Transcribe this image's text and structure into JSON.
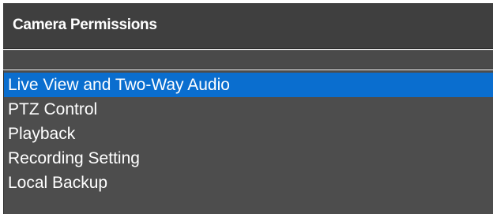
{
  "header": {
    "title": "Camera Permissions"
  },
  "permissions": {
    "items": [
      {
        "label": "Live View and Two-Way Audio",
        "selected": true
      },
      {
        "label": "PTZ Control",
        "selected": false
      },
      {
        "label": "Playback",
        "selected": false
      },
      {
        "label": "Recording Setting",
        "selected": false
      },
      {
        "label": "Local Backup",
        "selected": false
      }
    ],
    "selected_color": "#0a6ecf"
  },
  "colors": {
    "panel_background": "#4d4d4d",
    "header_background": "#3f3f3f",
    "text": "#ffffff"
  }
}
